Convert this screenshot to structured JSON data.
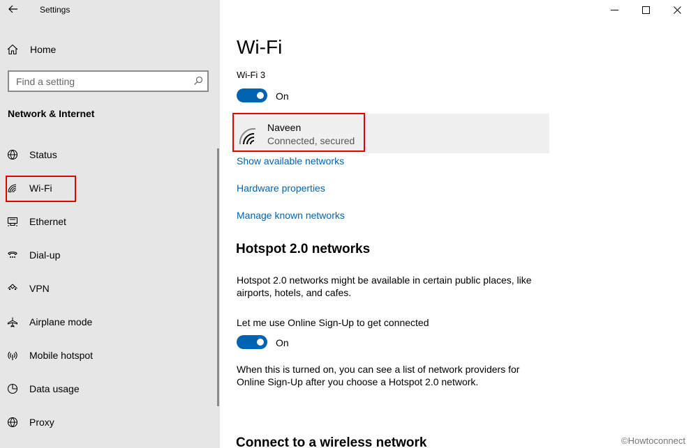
{
  "app": {
    "title": "Settings"
  },
  "sidebar": {
    "home_label": "Home",
    "search_placeholder": "Find a setting",
    "section_title": "Network & Internet",
    "items": [
      {
        "label": "Status",
        "icon": "globe-icon"
      },
      {
        "label": "Wi-Fi",
        "icon": "wifi-icon"
      },
      {
        "label": "Ethernet",
        "icon": "ethernet-icon"
      },
      {
        "label": "Dial-up",
        "icon": "dialup-icon"
      },
      {
        "label": "VPN",
        "icon": "vpn-icon"
      },
      {
        "label": "Airplane mode",
        "icon": "airplane-icon"
      },
      {
        "label": "Mobile hotspot",
        "icon": "hotspot-icon"
      },
      {
        "label": "Data usage",
        "icon": "data-usage-icon"
      },
      {
        "label": "Proxy",
        "icon": "globe-icon"
      }
    ]
  },
  "main": {
    "title": "Wi-Fi",
    "adapter_label": "Wi-Fi 3",
    "wifi_toggle_state": "On",
    "network": {
      "name": "Naveen",
      "status": "Connected, secured"
    },
    "links": {
      "show_available": "Show available networks",
      "hardware_properties": "Hardware properties",
      "manage_known": "Manage known networks"
    },
    "hotspot": {
      "heading": "Hotspot 2.0 networks",
      "description": "Hotspot 2.0 networks might be available in certain public places, like airports, hotels, and cafes.",
      "signup_label": "Let me use Online Sign-Up to get connected",
      "signup_toggle_state": "On",
      "signup_description": "When this is turned on, you can see a list of network providers for Online Sign-Up after you choose a Hotspot 2.0 network."
    },
    "connect_heading": "Connect to a wireless network"
  },
  "watermark": "©Howtoconnect",
  "colors": {
    "accent": "#0063b1",
    "highlight": "#e30000",
    "sidebar_bg": "#e6e6e6"
  }
}
